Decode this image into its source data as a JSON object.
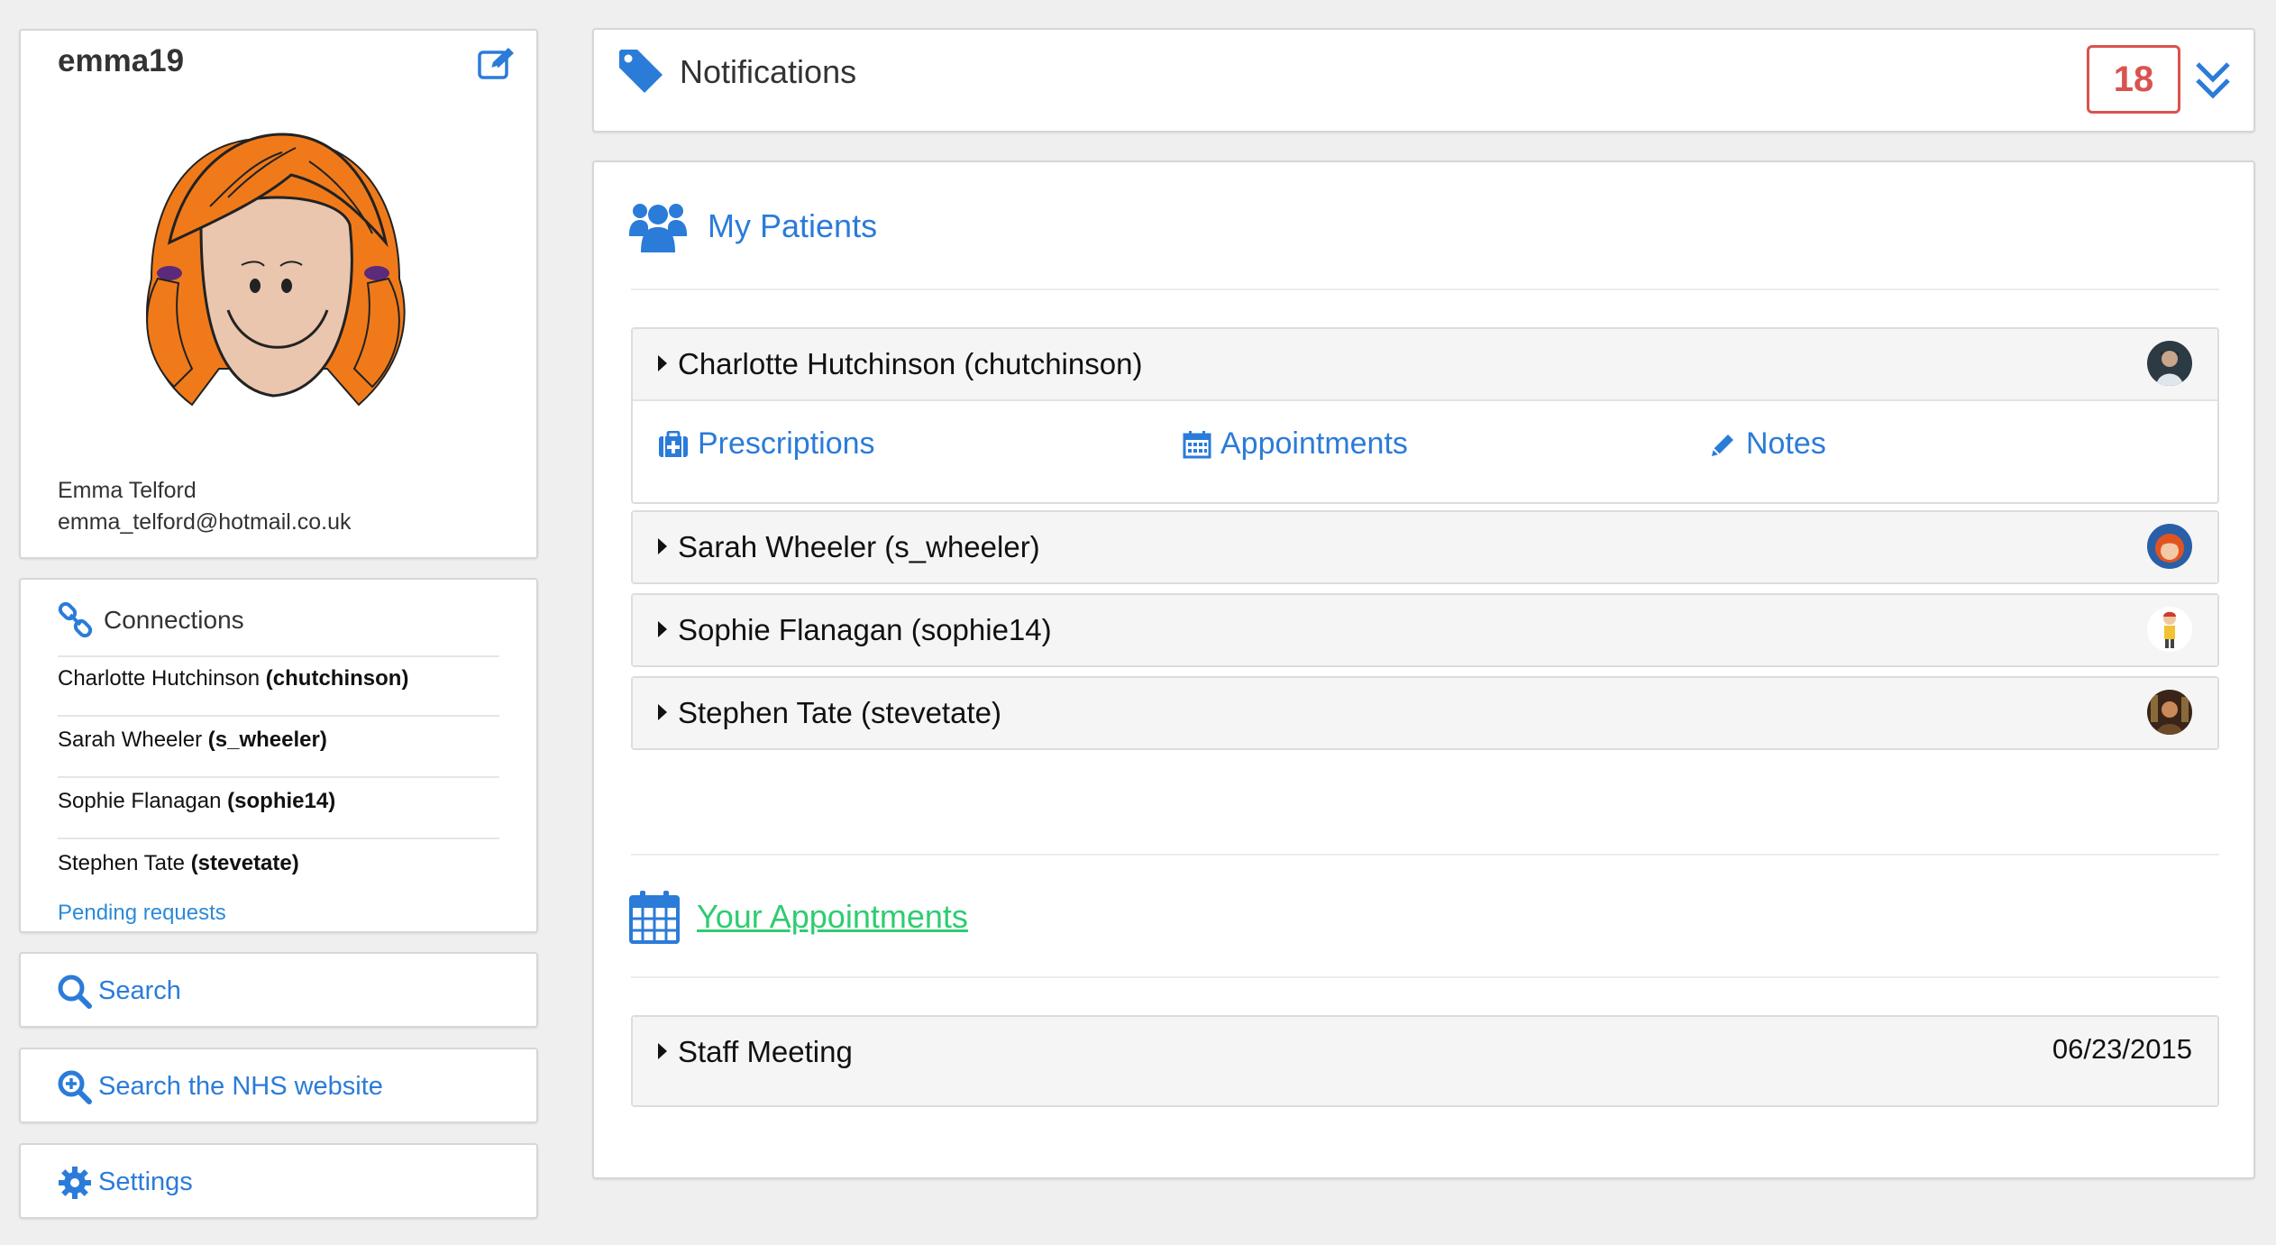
{
  "profile": {
    "username": "emma19",
    "full_name": "Emma Telford",
    "email": "emma_telford@hotmail.co.uk"
  },
  "connections": {
    "title": "Connections",
    "items": [
      {
        "name": "Charlotte Hutchinson",
        "handle": "(chutchinson)"
      },
      {
        "name": "Sarah Wheeler",
        "handle": "(s_wheeler)"
      },
      {
        "name": "Sophie Flanagan",
        "handle": "(sophie14)"
      },
      {
        "name": "Stephen Tate",
        "handle": "(stevetate)"
      }
    ],
    "pending": "Pending requests"
  },
  "sidebar": {
    "search": "Search",
    "nhs": "Search the NHS website",
    "settings": "Settings"
  },
  "notifications": {
    "title": "Notifications",
    "count": "18"
  },
  "patients": {
    "title": "My Patients",
    "items": [
      {
        "label": "Charlotte Hutchinson (chutchinson)",
        "expanded": true
      },
      {
        "label": "Sarah Wheeler (s_wheeler)",
        "expanded": false
      },
      {
        "label": "Sophie Flanagan (sophie14)",
        "expanded": false
      },
      {
        "label": "Stephen Tate (stevetate)",
        "expanded": false
      }
    ],
    "actions": {
      "prescriptions": "Prescriptions",
      "appointments": "Appointments",
      "notes": "Notes"
    }
  },
  "appointments": {
    "title": "Your Appointments",
    "items": [
      {
        "label": "Staff Meeting",
        "date": "06/23/2015"
      }
    ]
  },
  "colors": {
    "accent": "#2b7bd9",
    "badge": "#d9534f",
    "appointments_link": "#2ecc71"
  }
}
